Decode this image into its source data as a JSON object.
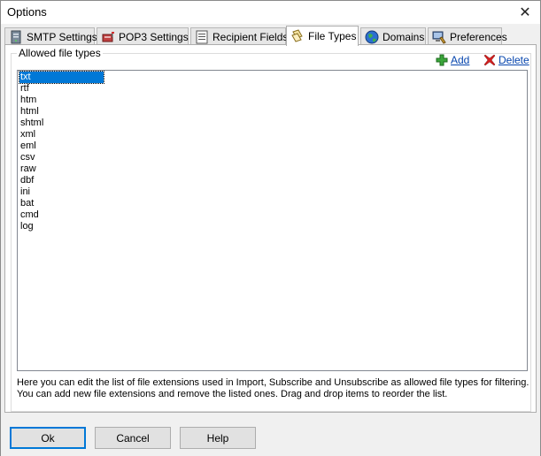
{
  "window": {
    "title": "Options"
  },
  "tabs": [
    {
      "label": "SMTP Settings",
      "icon": "server-icon"
    },
    {
      "label": "POP3 Settings",
      "icon": "mailbox-icon"
    },
    {
      "label": "Recipient Fields",
      "icon": "form-icon"
    },
    {
      "label": "File Types",
      "icon": "file-types-icon"
    },
    {
      "label": "Domains",
      "icon": "globe-icon"
    },
    {
      "label": "Preferences",
      "icon": "preferences-icon"
    }
  ],
  "active_tab": "File Types",
  "file_types": {
    "group_label": "Allowed file types",
    "add_label": "Add",
    "delete_label": "Delete",
    "items": [
      "txt",
      "rtf",
      "htm",
      "html",
      "shtml",
      "xml",
      "eml",
      "csv",
      "raw",
      "dbf",
      "ini",
      "bat",
      "cmd",
      "log"
    ],
    "selected_item": "txt",
    "help_text": "Here you can edit the list of file extensions used in Import, Subscribe and Unsubscribe as allowed file types for filtering. You can add new file extensions and remove the listed ones. Drag and drop items to reorder the list."
  },
  "buttons": {
    "ok": "Ok",
    "cancel": "Cancel",
    "help": "Help"
  },
  "colors": {
    "selection": "#0078d7",
    "link": "#0645ad",
    "add_icon": "#3aa63a",
    "delete_icon": "#d42020"
  }
}
